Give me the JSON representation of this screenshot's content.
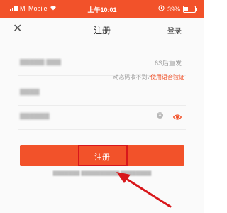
{
  "status_bar": {
    "carrier": "Mi Mobile",
    "time": "上午10:01",
    "battery": "39%"
  },
  "nav": {
    "title": "注册",
    "login": "登录"
  },
  "form": {
    "resend_label": "6S后重发",
    "voice_prompt": "动态码收不到?",
    "voice_link": "使用语音验证"
  },
  "register_button": {
    "label": "注册"
  },
  "colors": {
    "brand": "#f2522a",
    "highlight": "#d8171b"
  }
}
